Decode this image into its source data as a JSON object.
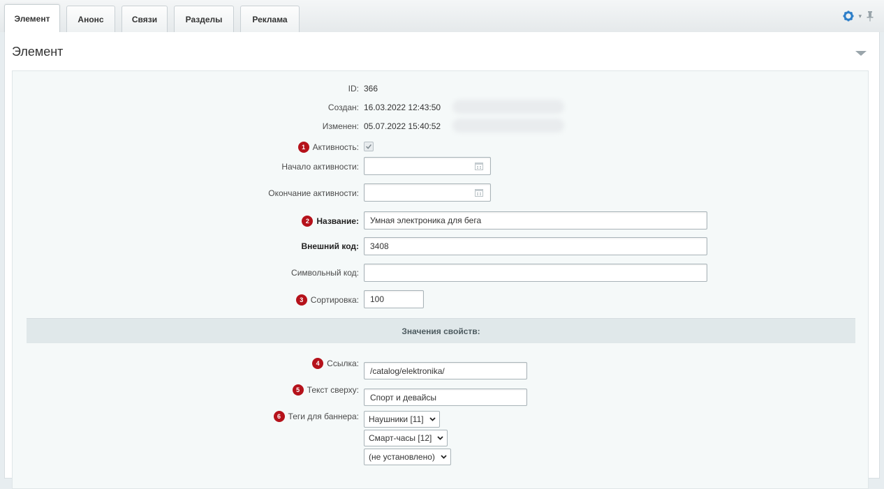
{
  "tabs": [
    {
      "label": "Элемент",
      "active": true
    },
    {
      "label": "Анонс",
      "active": false
    },
    {
      "label": "Связи",
      "active": false
    },
    {
      "label": "Разделы",
      "active": false
    },
    {
      "label": "Реклама",
      "active": false
    }
  ],
  "toolbar": {
    "settings_icon": "gear-icon",
    "pin_icon": "pin-icon"
  },
  "section": {
    "title": "Элемент"
  },
  "fields": {
    "id": {
      "label": "ID:",
      "value": "366"
    },
    "created": {
      "label": "Создан:",
      "value": "16.03.2022 12:43:50"
    },
    "modified": {
      "label": "Изменен:",
      "value": "05.07.2022 15:40:52"
    },
    "active": {
      "label": "Активность:",
      "badge": "1",
      "checked": true
    },
    "active_from": {
      "label": "Начало активности:",
      "value": ""
    },
    "active_to": {
      "label": "Окончание активности:",
      "value": ""
    },
    "name": {
      "label": "Название:",
      "badge": "2",
      "value": "Умная электроника для бега"
    },
    "external_code": {
      "label": "Внешний код:",
      "value": "3408"
    },
    "symbol_code": {
      "label": "Символьный код:",
      "value": ""
    },
    "sort": {
      "label": "Сортировка:",
      "badge": "3",
      "value": "100"
    }
  },
  "properties": {
    "header": "Значения свойств:",
    "link": {
      "label": "Ссылка:",
      "badge": "4",
      "value": "/catalog/elektronika/"
    },
    "top_text": {
      "label": "Текст сверху:",
      "badge": "5",
      "value": "Спорт и девайсы"
    },
    "banner_tags": {
      "label": "Теги для баннера:",
      "badge": "6",
      "selected": [
        "Наушники [11]",
        "Смарт-часы [12]",
        "(не установлено)"
      ]
    }
  },
  "colors": {
    "accent_badge": "#b5121b",
    "panel_bg": "#f5f9f9",
    "header_bg": "#e0e8ea"
  }
}
